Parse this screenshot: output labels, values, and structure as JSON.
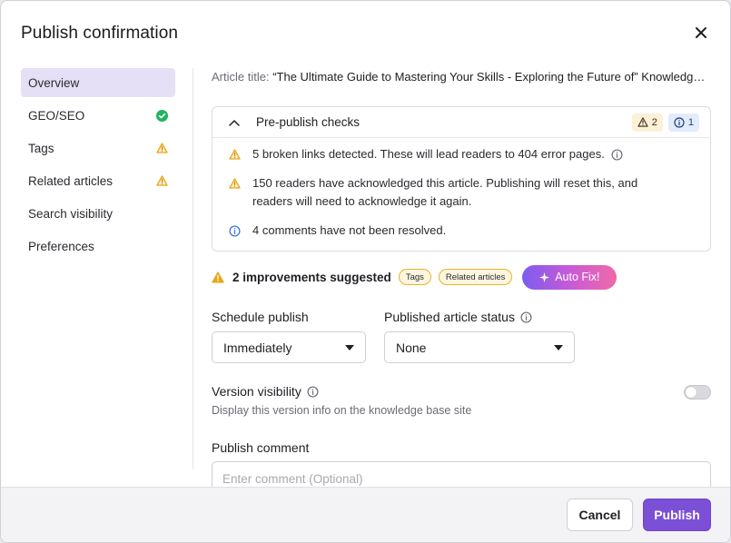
{
  "dialog": {
    "title": "Publish confirmation"
  },
  "sidebar": {
    "items": [
      {
        "label": "Overview",
        "status": "none"
      },
      {
        "label": "GEO/SEO",
        "status": "success"
      },
      {
        "label": "Tags",
        "status": "warning"
      },
      {
        "label": "Related articles",
        "status": "warning"
      },
      {
        "label": "Search visibility",
        "status": "none"
      },
      {
        "label": "Preferences",
        "status": "none"
      }
    ]
  },
  "article": {
    "title_label": "Article title:",
    "title_value": "“The Ultimate Guide to Mastering Your Skills - Exploring the Future of” Knowledge Management"
  },
  "checks": {
    "title": "Pre-publish checks",
    "warning_count": "2",
    "info_count": "1",
    "items": [
      {
        "type": "warning",
        "text": "5 broken links detected. These will lead readers to 404 error pages."
      },
      {
        "type": "warning",
        "text": "150 readers have acknowledged this article. Publishing will reset this, and readers will need to acknowledge it again."
      },
      {
        "type": "info",
        "text": "4 comments have not been resolved."
      }
    ]
  },
  "improvements": {
    "text": "2 improvements suggested",
    "chips": [
      "Tags",
      "Related articles"
    ],
    "autofix_label": "Auto Fix!"
  },
  "schedule": {
    "label": "Schedule publish",
    "value": "Immediately"
  },
  "status": {
    "label": "Published article status",
    "value": "None"
  },
  "version": {
    "label": "Version visibility",
    "description": "Display this version info on the knowledge base site",
    "enabled": false
  },
  "comment": {
    "label": "Publish comment",
    "placeholder": "Enter comment (Optional)"
  },
  "footer": {
    "cancel_label": "Cancel",
    "publish_label": "Publish"
  },
  "colors": {
    "accent": "#7b4fd6",
    "warning": "#e6a817",
    "success": "#22b35e",
    "info": "#2f6fd6"
  }
}
